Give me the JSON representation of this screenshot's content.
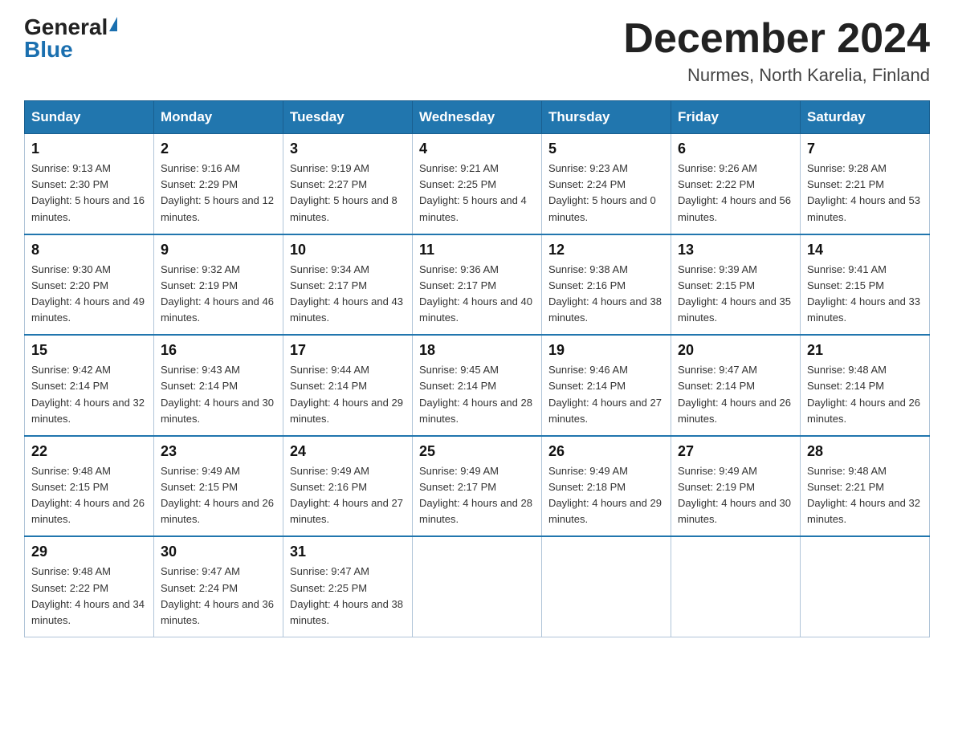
{
  "header": {
    "logo_general": "General",
    "logo_blue": "Blue",
    "month_title": "December 2024",
    "location": "Nurmes, North Karelia, Finland"
  },
  "days_of_week": [
    "Sunday",
    "Monday",
    "Tuesday",
    "Wednesday",
    "Thursday",
    "Friday",
    "Saturday"
  ],
  "weeks": [
    [
      {
        "day": "1",
        "sunrise": "9:13 AM",
        "sunset": "2:30 PM",
        "daylight": "5 hours and 16 minutes."
      },
      {
        "day": "2",
        "sunrise": "9:16 AM",
        "sunset": "2:29 PM",
        "daylight": "5 hours and 12 minutes."
      },
      {
        "day": "3",
        "sunrise": "9:19 AM",
        "sunset": "2:27 PM",
        "daylight": "5 hours and 8 minutes."
      },
      {
        "day": "4",
        "sunrise": "9:21 AM",
        "sunset": "2:25 PM",
        "daylight": "5 hours and 4 minutes."
      },
      {
        "day": "5",
        "sunrise": "9:23 AM",
        "sunset": "2:24 PM",
        "daylight": "5 hours and 0 minutes."
      },
      {
        "day": "6",
        "sunrise": "9:26 AM",
        "sunset": "2:22 PM",
        "daylight": "4 hours and 56 minutes."
      },
      {
        "day": "7",
        "sunrise": "9:28 AM",
        "sunset": "2:21 PM",
        "daylight": "4 hours and 53 minutes."
      }
    ],
    [
      {
        "day": "8",
        "sunrise": "9:30 AM",
        "sunset": "2:20 PM",
        "daylight": "4 hours and 49 minutes."
      },
      {
        "day": "9",
        "sunrise": "9:32 AM",
        "sunset": "2:19 PM",
        "daylight": "4 hours and 46 minutes."
      },
      {
        "day": "10",
        "sunrise": "9:34 AM",
        "sunset": "2:17 PM",
        "daylight": "4 hours and 43 minutes."
      },
      {
        "day": "11",
        "sunrise": "9:36 AM",
        "sunset": "2:17 PM",
        "daylight": "4 hours and 40 minutes."
      },
      {
        "day": "12",
        "sunrise": "9:38 AM",
        "sunset": "2:16 PM",
        "daylight": "4 hours and 38 minutes."
      },
      {
        "day": "13",
        "sunrise": "9:39 AM",
        "sunset": "2:15 PM",
        "daylight": "4 hours and 35 minutes."
      },
      {
        "day": "14",
        "sunrise": "9:41 AM",
        "sunset": "2:15 PM",
        "daylight": "4 hours and 33 minutes."
      }
    ],
    [
      {
        "day": "15",
        "sunrise": "9:42 AM",
        "sunset": "2:14 PM",
        "daylight": "4 hours and 32 minutes."
      },
      {
        "day": "16",
        "sunrise": "9:43 AM",
        "sunset": "2:14 PM",
        "daylight": "4 hours and 30 minutes."
      },
      {
        "day": "17",
        "sunrise": "9:44 AM",
        "sunset": "2:14 PM",
        "daylight": "4 hours and 29 minutes."
      },
      {
        "day": "18",
        "sunrise": "9:45 AM",
        "sunset": "2:14 PM",
        "daylight": "4 hours and 28 minutes."
      },
      {
        "day": "19",
        "sunrise": "9:46 AM",
        "sunset": "2:14 PM",
        "daylight": "4 hours and 27 minutes."
      },
      {
        "day": "20",
        "sunrise": "9:47 AM",
        "sunset": "2:14 PM",
        "daylight": "4 hours and 26 minutes."
      },
      {
        "day": "21",
        "sunrise": "9:48 AM",
        "sunset": "2:14 PM",
        "daylight": "4 hours and 26 minutes."
      }
    ],
    [
      {
        "day": "22",
        "sunrise": "9:48 AM",
        "sunset": "2:15 PM",
        "daylight": "4 hours and 26 minutes."
      },
      {
        "day": "23",
        "sunrise": "9:49 AM",
        "sunset": "2:15 PM",
        "daylight": "4 hours and 26 minutes."
      },
      {
        "day": "24",
        "sunrise": "9:49 AM",
        "sunset": "2:16 PM",
        "daylight": "4 hours and 27 minutes."
      },
      {
        "day": "25",
        "sunrise": "9:49 AM",
        "sunset": "2:17 PM",
        "daylight": "4 hours and 28 minutes."
      },
      {
        "day": "26",
        "sunrise": "9:49 AM",
        "sunset": "2:18 PM",
        "daylight": "4 hours and 29 minutes."
      },
      {
        "day": "27",
        "sunrise": "9:49 AM",
        "sunset": "2:19 PM",
        "daylight": "4 hours and 30 minutes."
      },
      {
        "day": "28",
        "sunrise": "9:48 AM",
        "sunset": "2:21 PM",
        "daylight": "4 hours and 32 minutes."
      }
    ],
    [
      {
        "day": "29",
        "sunrise": "9:48 AM",
        "sunset": "2:22 PM",
        "daylight": "4 hours and 34 minutes."
      },
      {
        "day": "30",
        "sunrise": "9:47 AM",
        "sunset": "2:24 PM",
        "daylight": "4 hours and 36 minutes."
      },
      {
        "day": "31",
        "sunrise": "9:47 AM",
        "sunset": "2:25 PM",
        "daylight": "4 hours and 38 minutes."
      },
      null,
      null,
      null,
      null
    ]
  ]
}
